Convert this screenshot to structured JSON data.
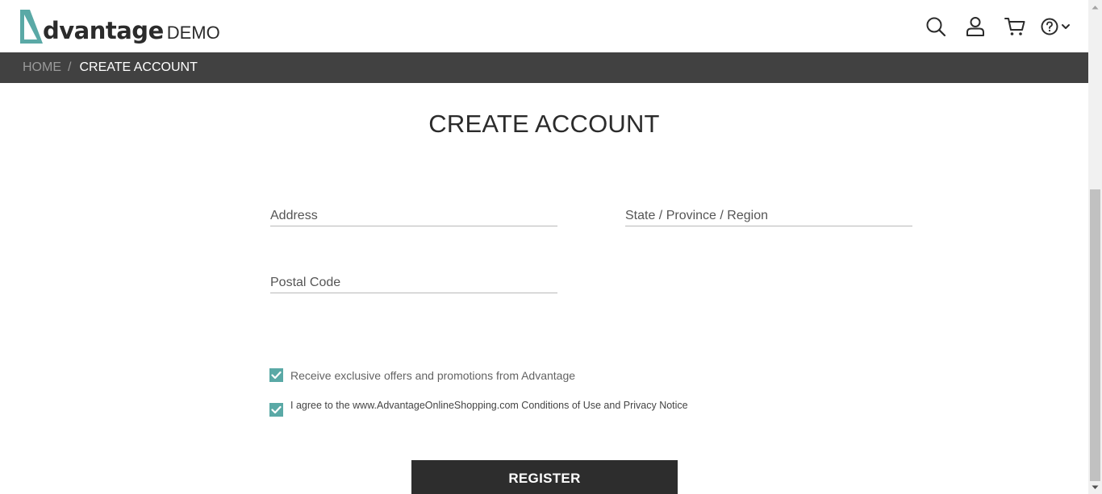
{
  "header": {
    "logo_word": "dvantage",
    "logo_demo": "DEMO",
    "logo_color": "#5aa9a6",
    "icons": [
      "search-icon",
      "user-icon",
      "cart-icon",
      "help-icon",
      "chevron-down-icon"
    ]
  },
  "breadcrumb": {
    "home": "HOME",
    "separator": "/",
    "current": "CREATE ACCOUNT"
  },
  "page_title": "CREATE ACCOUNT",
  "form": {
    "address": {
      "placeholder": "Address",
      "value": ""
    },
    "state": {
      "placeholder": "State / Province / Region",
      "value": ""
    },
    "postal_code": {
      "placeholder": "Postal Code",
      "value": ""
    }
  },
  "checkboxes": {
    "offers": {
      "label": "Receive exclusive offers and promotions from Advantage",
      "checked": true
    },
    "agree": {
      "label": "I agree to the www.AdvantageOnlineShopping.com Conditions of Use and Privacy Notice",
      "checked": true
    }
  },
  "register_label": "REGISTER",
  "colors": {
    "accent": "#5aa9a6",
    "breadcrumb_bg": "#414141",
    "button_bg": "#2d2d2d"
  }
}
